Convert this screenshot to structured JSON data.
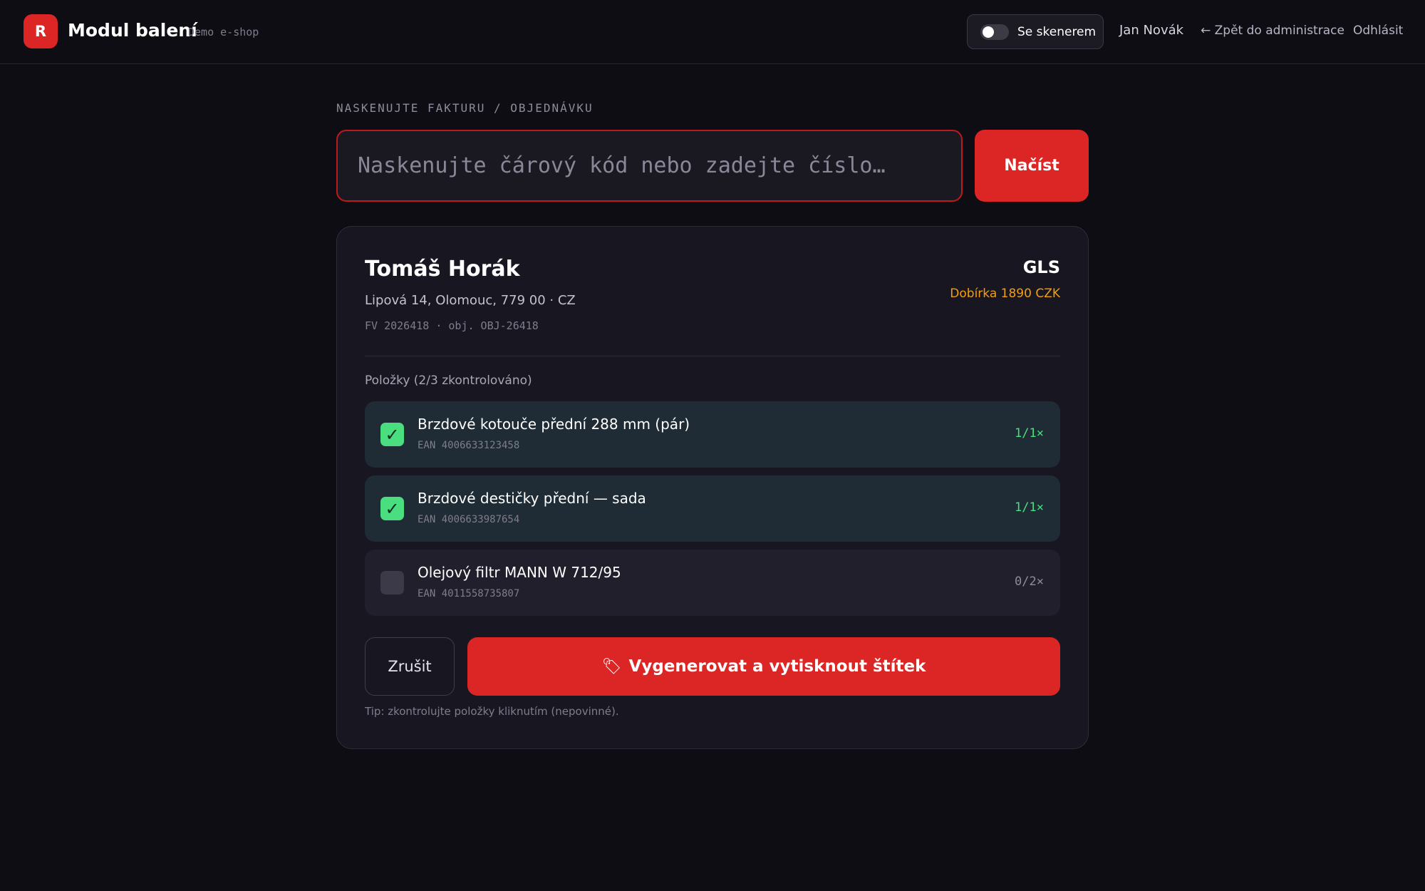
{
  "header": {
    "logo_letter": "R",
    "app_title": "Modul balení",
    "app_subtitle": "Demo e-shop",
    "scanner_toggle_label": "Se skenerem",
    "scanner_toggle_on": false,
    "user_name": "Jan Novák",
    "back_link": "← Zpět do administrace",
    "logout_link": "Odhlásit"
  },
  "scan": {
    "label": "NASKENUJTE FAKTURU / OBJEDNÁVKU",
    "placeholder": "Naskenujte čárový kód nebo zadejte číslo…",
    "value": "",
    "submit_label": "Načíst"
  },
  "order": {
    "customer_name": "Tomáš Horák",
    "address": "Lipová 14, Olomouc, 779 00 · CZ",
    "refs": "FV 2026418 · obj. OBJ-26418",
    "carrier": "GLS",
    "cod": "Dobírka 1890 CZK",
    "items_heading": "Položky (2/3 zkontrolováno)",
    "items": [
      {
        "name": "Brzdové kotouče přední 288 mm (pár)",
        "ean": "EAN 4006633123458",
        "qty": "1/1×",
        "checked": true,
        "check_glyph": "✓"
      },
      {
        "name": "Brzdové destičky přední — sada",
        "ean": "EAN 4006633987654",
        "qty": "1/1×",
        "checked": true,
        "check_glyph": "✓"
      },
      {
        "name": "Olejový filtr MANN W 712/95",
        "ean": "EAN 4011558735807",
        "qty": "0/2×",
        "checked": false,
        "check_glyph": ""
      }
    ],
    "cancel_label": "Zrušit",
    "print_icon": "🏷",
    "print_label": "Vygenerovat a vytisknout štítek",
    "tip": "Tip: zkontrolujte položky kliknutím (nepovinné)."
  },
  "colors": {
    "accent": "#dc2626",
    "checked": "#4ade80",
    "cod": "#f59e0b",
    "background": "#0e0d14",
    "card": "#181721"
  }
}
